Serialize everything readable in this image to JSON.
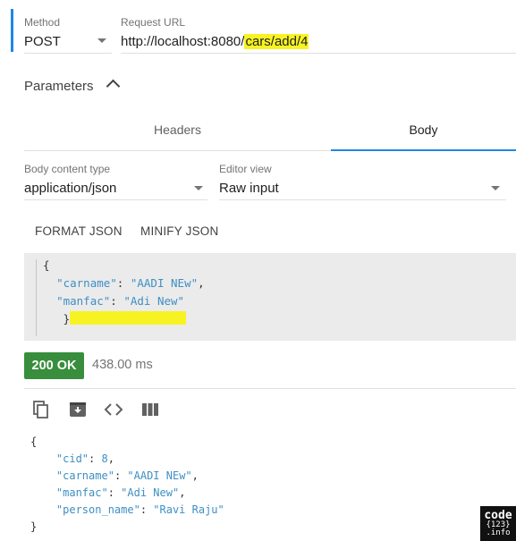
{
  "request": {
    "method_label": "Method",
    "method_value": "POST",
    "url_label": "Request URL",
    "url_prefix": "http://localhost:8080/",
    "url_highlight": "cars/add/4"
  },
  "parameters": {
    "title": "Parameters"
  },
  "tabs": [
    {
      "label": "Headers"
    },
    {
      "label": "Body",
      "active": true
    }
  ],
  "body_settings": {
    "content_type_label": "Body content type",
    "content_type_value": "application/json",
    "editor_view_label": "Editor view",
    "editor_view_value": "Raw input"
  },
  "actions": {
    "format_json": "FORMAT JSON",
    "minify_json": "MINIFY JSON"
  },
  "request_body": {
    "open": "{",
    "line1_key": "\"carname\"",
    "line1_sep": ": ",
    "line1_val": "\"AADI NEw\"",
    "line1_end": ",",
    "line2_key": "\"manfac\"",
    "line2_sep": ": ",
    "line2_val": "\"Adi New\"",
    "close": "}"
  },
  "response": {
    "status": "200 OK",
    "time": "438.00 ms",
    "body": {
      "open": "{",
      "cid_key": "\"cid\"",
      "cid_val": "8",
      "carname_key": "\"carname\"",
      "carname_val": "\"AADI NEw\"",
      "manfac_key": "\"manfac\"",
      "manfac_val": "\"Adi New\"",
      "person_key": "\"person_name\"",
      "person_val": "\"Ravi Raju\"",
      "close": "}"
    }
  },
  "toolbar_icons": [
    "copy-icon",
    "archive-icon",
    "code-icon",
    "columns-icon"
  ],
  "watermark": {
    "line1": "code",
    "line2": "{123}",
    "line3": ".info"
  },
  "colors": {
    "accent": "#1e88e5",
    "status_ok": "#388e3c",
    "highlight": "#f7f323",
    "json_text": "#3f8fc4",
    "editor_bg": "#ebebeb"
  }
}
